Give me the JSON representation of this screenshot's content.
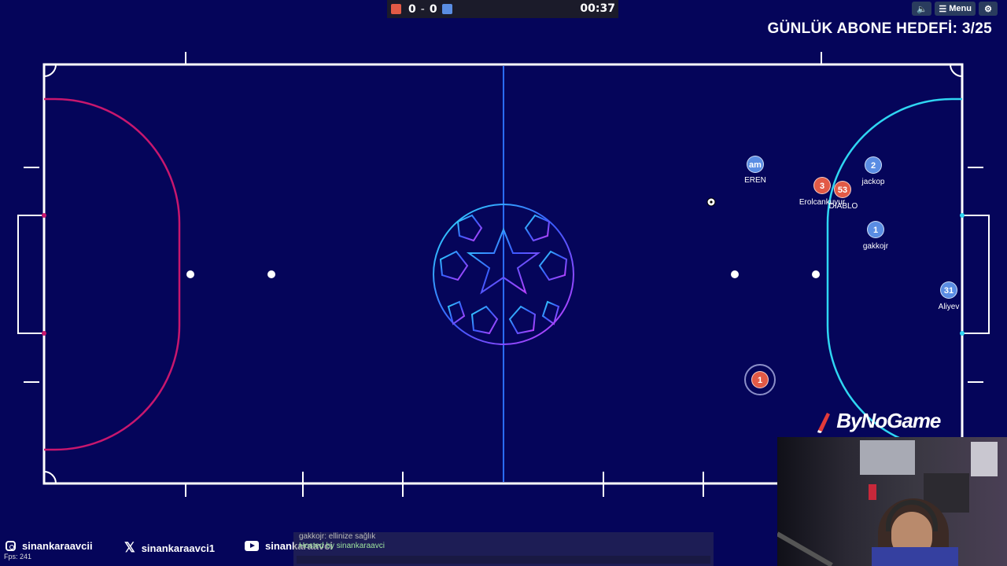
{
  "scoreboard": {
    "red_score": "0",
    "separator": "-",
    "blue_score": "0",
    "time": "00:37",
    "red_color": "#e25a46",
    "blue_color": "#5a8de3"
  },
  "top_right": {
    "sound_icon": "speaker-icon",
    "menu_label": "Menu",
    "settings_icon": "gear-icon"
  },
  "overlay": {
    "goal_text": "GÜNLÜK ABONE HEDEFİ: 3/25",
    "brand": "ByNoGame"
  },
  "players": [
    {
      "team": "blue",
      "badge": "am",
      "name": "EREN"
    },
    {
      "team": "red",
      "badge": "3",
      "name": "Erolcankuyur"
    },
    {
      "team": "red",
      "badge": "53",
      "name": "DIABLO"
    },
    {
      "team": "blue",
      "badge": "2",
      "name": "jackop"
    },
    {
      "team": "blue",
      "badge": "1",
      "name": "gakkojr"
    },
    {
      "team": "blue",
      "badge": "31",
      "name": "Aliyev"
    },
    {
      "team": "red",
      "badge": "1",
      "name": ""
    }
  ],
  "socials": [
    {
      "icon": "instagram-icon",
      "handle": "sinankaraavcii"
    },
    {
      "icon": "x-icon",
      "handle": "sinankaraavci1"
    },
    {
      "icon": "youtube-icon",
      "handle": "sinankaraavci"
    }
  ],
  "chat": {
    "line1": "gakkojr: ellinize sağlık",
    "line2": "Hosted by sinankaraavci"
  },
  "fps": "Fps: 241",
  "colors": {
    "field_bg": "#05055a",
    "left_box": "#c8176e",
    "right_box": "#2fd6f2",
    "center_line": "#2a6cff"
  }
}
